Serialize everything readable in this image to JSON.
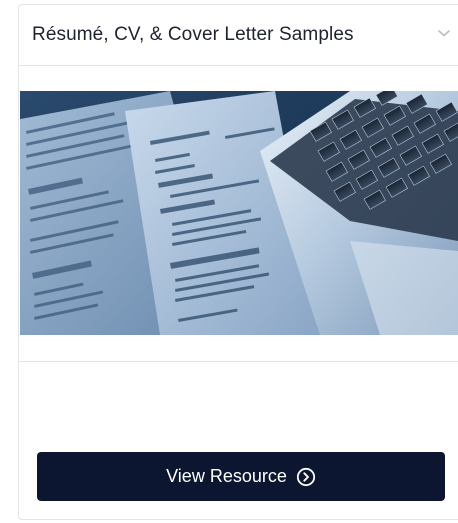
{
  "card": {
    "title": "Résumé, CV, & Cover Letter Samples",
    "expand_icon": "chevron-down-icon",
    "image": {
      "subject": "resume-documents-with-laptop-photo",
      "paper_text": {
        "curriculum_vitae": "CURRICULUM VITAE",
        "name": "Acc Another",
        "objective": "Objective",
        "highlights": "Highlights",
        "education": "Education",
        "employment_history": "Employment History",
        "references": "References"
      }
    },
    "button": {
      "label": "View Resource",
      "icon": "circle-arrow-right-icon"
    }
  },
  "colors": {
    "button_bg": "#0d1631",
    "button_text": "#ffffff",
    "title_text": "#1f2330",
    "border": "#e4e4e4"
  }
}
